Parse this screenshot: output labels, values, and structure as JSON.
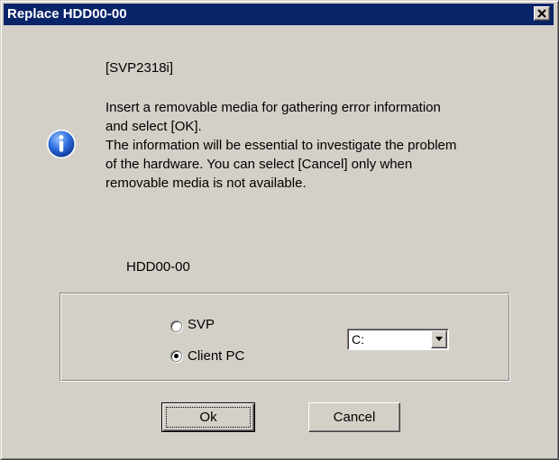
{
  "window": {
    "title": "Replace HDD00-00",
    "close_glyph": "close-icon"
  },
  "dialog": {
    "icon": "info-icon",
    "code": "[SVP2318i]",
    "message_lines": [
      "Insert a removable media for gathering error information",
      "and select [OK].",
      "The information will be essential to investigate the problem",
      "of the hardware. You can select [Cancel] only when",
      "removable media is not available."
    ],
    "device_label": "HDD00-00"
  },
  "destination": {
    "options": [
      {
        "label": "SVP",
        "selected": false
      },
      {
        "label": "Client PC",
        "selected": true
      }
    ],
    "drive_select": {
      "value": "C:"
    }
  },
  "buttons": {
    "ok_label": "Ok",
    "cancel_label": "Cancel"
  },
  "colors": {
    "titlebar": "#0a246a",
    "face": "#d4d0c8",
    "info_icon": "#1c5fd0"
  }
}
